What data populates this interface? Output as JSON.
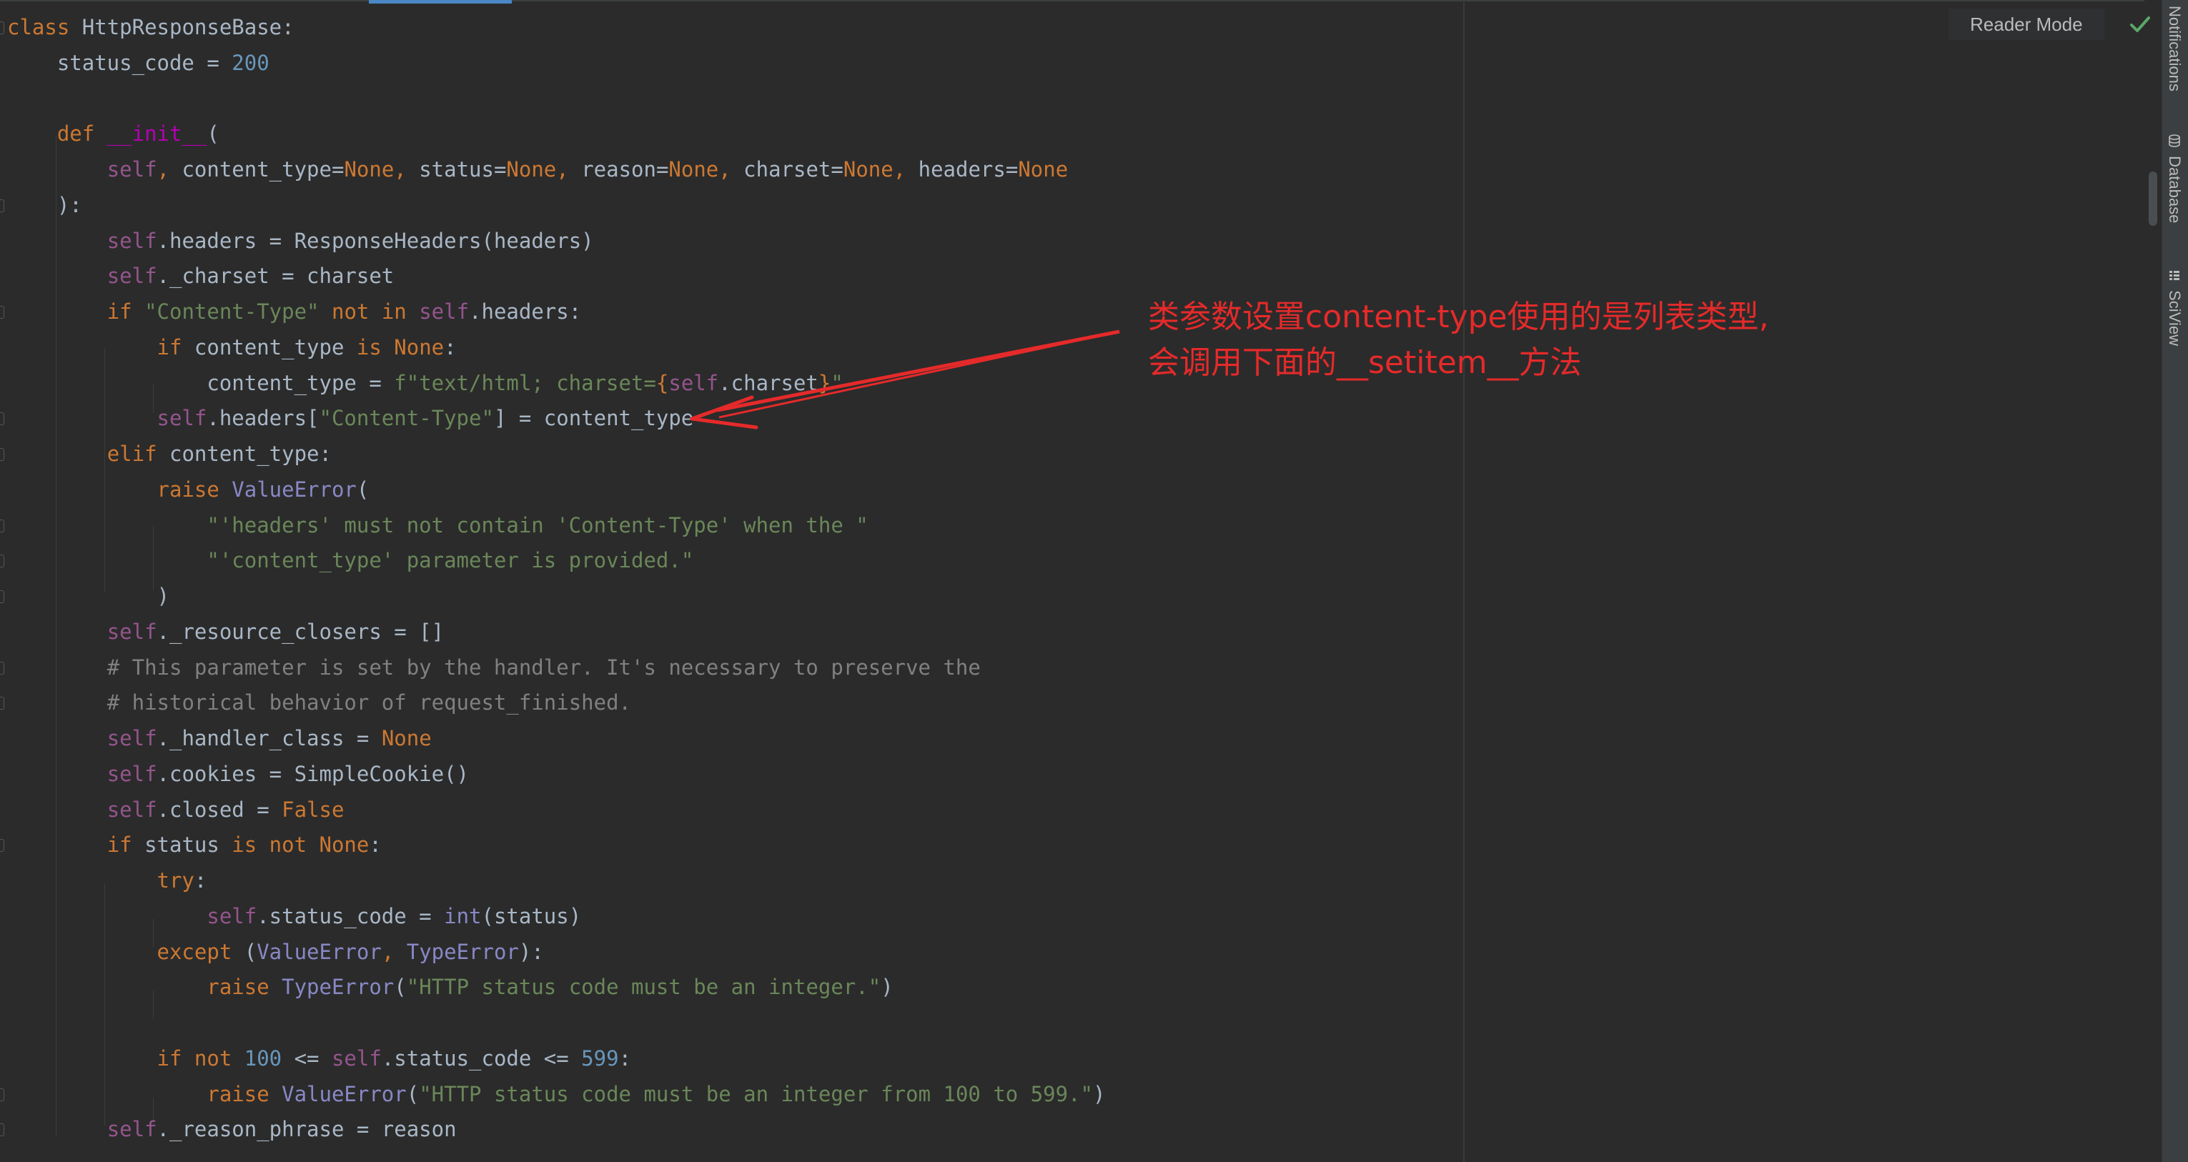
{
  "toolbar": {
    "reader_mode_label": "Reader Mode"
  },
  "sidebar": {
    "items": [
      {
        "label": "Notifications",
        "icon": "bell-icon"
      },
      {
        "label": "Database",
        "icon": "database-icon"
      },
      {
        "label": "SciView",
        "icon": "sciview-icon"
      }
    ]
  },
  "annotation": {
    "line1": "类参数设置content-type使用的是列表类型,",
    "line2": "会调用下面的__setitem__方法",
    "color": "#e52a2a"
  },
  "colors": {
    "editor_bg": "#2b2b2b",
    "keyword": "#cc7832",
    "self": "#94558d",
    "number": "#6897bb",
    "string": "#6a8759",
    "comment": "#808080",
    "function": "#ffc66d",
    "dunder": "#b200b2",
    "builtin": "#8888c6",
    "text": "#a9b7c6",
    "check": "#59a869"
  },
  "code": {
    "lines": [
      {
        "fold": true,
        "tokens": [
          [
            "kw",
            "class"
          ],
          [
            "plain",
            " HttpResponseBase:"
          ]
        ]
      },
      {
        "fold": false,
        "tokens": [
          [
            "plain",
            "    status_code = "
          ],
          [
            "num",
            "200"
          ]
        ]
      },
      {
        "fold": false,
        "tokens": []
      },
      {
        "fold": false,
        "tokens": [
          [
            "plain",
            "    "
          ],
          [
            "kw",
            "def "
          ],
          [
            "dunder",
            "__init__"
          ],
          [
            "plain",
            "("
          ]
        ]
      },
      {
        "fold": false,
        "tokens": [
          [
            "plain",
            "        "
          ],
          [
            "self",
            "self"
          ],
          [
            "kw",
            ", "
          ],
          [
            "plain",
            "content_type="
          ],
          [
            "kw",
            "None, "
          ],
          [
            "plain",
            "status="
          ],
          [
            "kw",
            "None, "
          ],
          [
            "plain",
            "reason="
          ],
          [
            "kw",
            "None, "
          ],
          [
            "plain",
            "charset="
          ],
          [
            "kw",
            "None, "
          ],
          [
            "plain",
            "headers="
          ],
          [
            "kw",
            "None"
          ]
        ]
      },
      {
        "fold": true,
        "tokens": [
          [
            "plain",
            "    ):"
          ]
        ]
      },
      {
        "fold": false,
        "tokens": [
          [
            "plain",
            "        "
          ],
          [
            "self",
            "self"
          ],
          [
            "plain",
            ".headers = ResponseHeaders(headers)"
          ]
        ]
      },
      {
        "fold": false,
        "tokens": [
          [
            "plain",
            "        "
          ],
          [
            "self",
            "self"
          ],
          [
            "plain",
            "._charset = charset"
          ]
        ]
      },
      {
        "fold": true,
        "tokens": [
          [
            "plain",
            "        "
          ],
          [
            "kw",
            "if "
          ],
          [
            "str",
            "\"Content-Type\" "
          ],
          [
            "kw",
            "not in "
          ],
          [
            "self",
            "self"
          ],
          [
            "plain",
            ".headers:"
          ]
        ]
      },
      {
        "fold": false,
        "tokens": [
          [
            "plain",
            "            "
          ],
          [
            "kw",
            "if "
          ],
          [
            "plain",
            "content_type "
          ],
          [
            "kw",
            "is None"
          ],
          [
            "plain",
            ":"
          ]
        ]
      },
      {
        "fold": false,
        "tokens": [
          [
            "plain",
            "                content_type = "
          ],
          [
            "str",
            "f\"text/html; charset="
          ],
          [
            "kw",
            "{"
          ],
          [
            "self",
            "self"
          ],
          [
            "plain",
            ".charset"
          ],
          [
            "kw",
            "}"
          ],
          [
            "str",
            "\""
          ]
        ]
      },
      {
        "fold": true,
        "tokens": [
          [
            "plain",
            "            "
          ],
          [
            "self",
            "self"
          ],
          [
            "plain",
            ".headers["
          ],
          [
            "str",
            "\"Content-Type\""
          ],
          [
            "plain",
            "] = content_type"
          ]
        ]
      },
      {
        "fold": true,
        "tokens": [
          [
            "plain",
            "        "
          ],
          [
            "kw",
            "elif "
          ],
          [
            "plain",
            "content_type:"
          ]
        ]
      },
      {
        "fold": false,
        "tokens": [
          [
            "plain",
            "            "
          ],
          [
            "kw",
            "raise "
          ],
          [
            "cls",
            "ValueError"
          ],
          [
            "plain",
            "("
          ]
        ]
      },
      {
        "fold": true,
        "tokens": [
          [
            "plain",
            "                "
          ],
          [
            "str",
            "\"'headers' must not contain 'Content-Type' when the \""
          ]
        ]
      },
      {
        "fold": true,
        "tokens": [
          [
            "plain",
            "                "
          ],
          [
            "str",
            "\"'content_type' parameter is provided.\""
          ]
        ]
      },
      {
        "fold": true,
        "tokens": [
          [
            "plain",
            "            )"
          ]
        ]
      },
      {
        "fold": false,
        "tokens": [
          [
            "plain",
            "        "
          ],
          [
            "self",
            "self"
          ],
          [
            "plain",
            "._resource_closers = []"
          ]
        ]
      },
      {
        "fold": true,
        "tokens": [
          [
            "plain",
            "        "
          ],
          [
            "cmt",
            "# This parameter is set by the handler. It's necessary to preserve the"
          ]
        ]
      },
      {
        "fold": true,
        "tokens": [
          [
            "plain",
            "        "
          ],
          [
            "cmt",
            "# historical behavior of request_finished."
          ]
        ]
      },
      {
        "fold": false,
        "tokens": [
          [
            "plain",
            "        "
          ],
          [
            "self",
            "self"
          ],
          [
            "plain",
            "._handler_class = "
          ],
          [
            "kw",
            "None"
          ]
        ]
      },
      {
        "fold": false,
        "tokens": [
          [
            "plain",
            "        "
          ],
          [
            "self",
            "self"
          ],
          [
            "plain",
            ".cookies = SimpleCookie()"
          ]
        ]
      },
      {
        "fold": false,
        "tokens": [
          [
            "plain",
            "        "
          ],
          [
            "self",
            "self"
          ],
          [
            "plain",
            ".closed = "
          ],
          [
            "kw",
            "False"
          ]
        ]
      },
      {
        "fold": true,
        "tokens": [
          [
            "plain",
            "        "
          ],
          [
            "kw",
            "if "
          ],
          [
            "plain",
            "status "
          ],
          [
            "kw",
            "is not None"
          ],
          [
            "plain",
            ":"
          ]
        ]
      },
      {
        "fold": false,
        "tokens": [
          [
            "plain",
            "            "
          ],
          [
            "kw",
            "try"
          ],
          [
            "plain",
            ":"
          ]
        ]
      },
      {
        "fold": false,
        "tokens": [
          [
            "plain",
            "                "
          ],
          [
            "self",
            "self"
          ],
          [
            "plain",
            ".status_code = "
          ],
          [
            "cls",
            "int"
          ],
          [
            "plain",
            "(status)"
          ]
        ]
      },
      {
        "fold": false,
        "tokens": [
          [
            "plain",
            "            "
          ],
          [
            "kw",
            "except "
          ],
          [
            "plain",
            "("
          ],
          [
            "cls",
            "ValueError"
          ],
          [
            "kw",
            ", "
          ],
          [
            "cls",
            "TypeError"
          ],
          [
            "plain",
            "):"
          ]
        ]
      },
      {
        "fold": false,
        "tokens": [
          [
            "plain",
            "                "
          ],
          [
            "kw",
            "raise "
          ],
          [
            "cls",
            "TypeError"
          ],
          [
            "plain",
            "("
          ],
          [
            "str",
            "\"HTTP status code must be an integer.\""
          ],
          [
            "plain",
            ")"
          ]
        ]
      },
      {
        "fold": false,
        "tokens": []
      },
      {
        "fold": false,
        "tokens": [
          [
            "plain",
            "            "
          ],
          [
            "kw",
            "if not "
          ],
          [
            "num",
            "100 "
          ],
          [
            "plain",
            "<= "
          ],
          [
            "self",
            "self"
          ],
          [
            "plain",
            ".status_code <= "
          ],
          [
            "num",
            "599"
          ],
          [
            "plain",
            ":"
          ]
        ]
      },
      {
        "fold": true,
        "tokens": [
          [
            "plain",
            "                "
          ],
          [
            "kw",
            "raise "
          ],
          [
            "cls",
            "ValueError"
          ],
          [
            "plain",
            "("
          ],
          [
            "str",
            "\"HTTP status code must be an integer from 100 to 599.\""
          ],
          [
            "plain",
            ")"
          ]
        ]
      },
      {
        "fold": true,
        "tokens": [
          [
            "plain",
            "        "
          ],
          [
            "self",
            "self"
          ],
          [
            "plain",
            "._reason_phrase = reason"
          ]
        ]
      }
    ]
  }
}
